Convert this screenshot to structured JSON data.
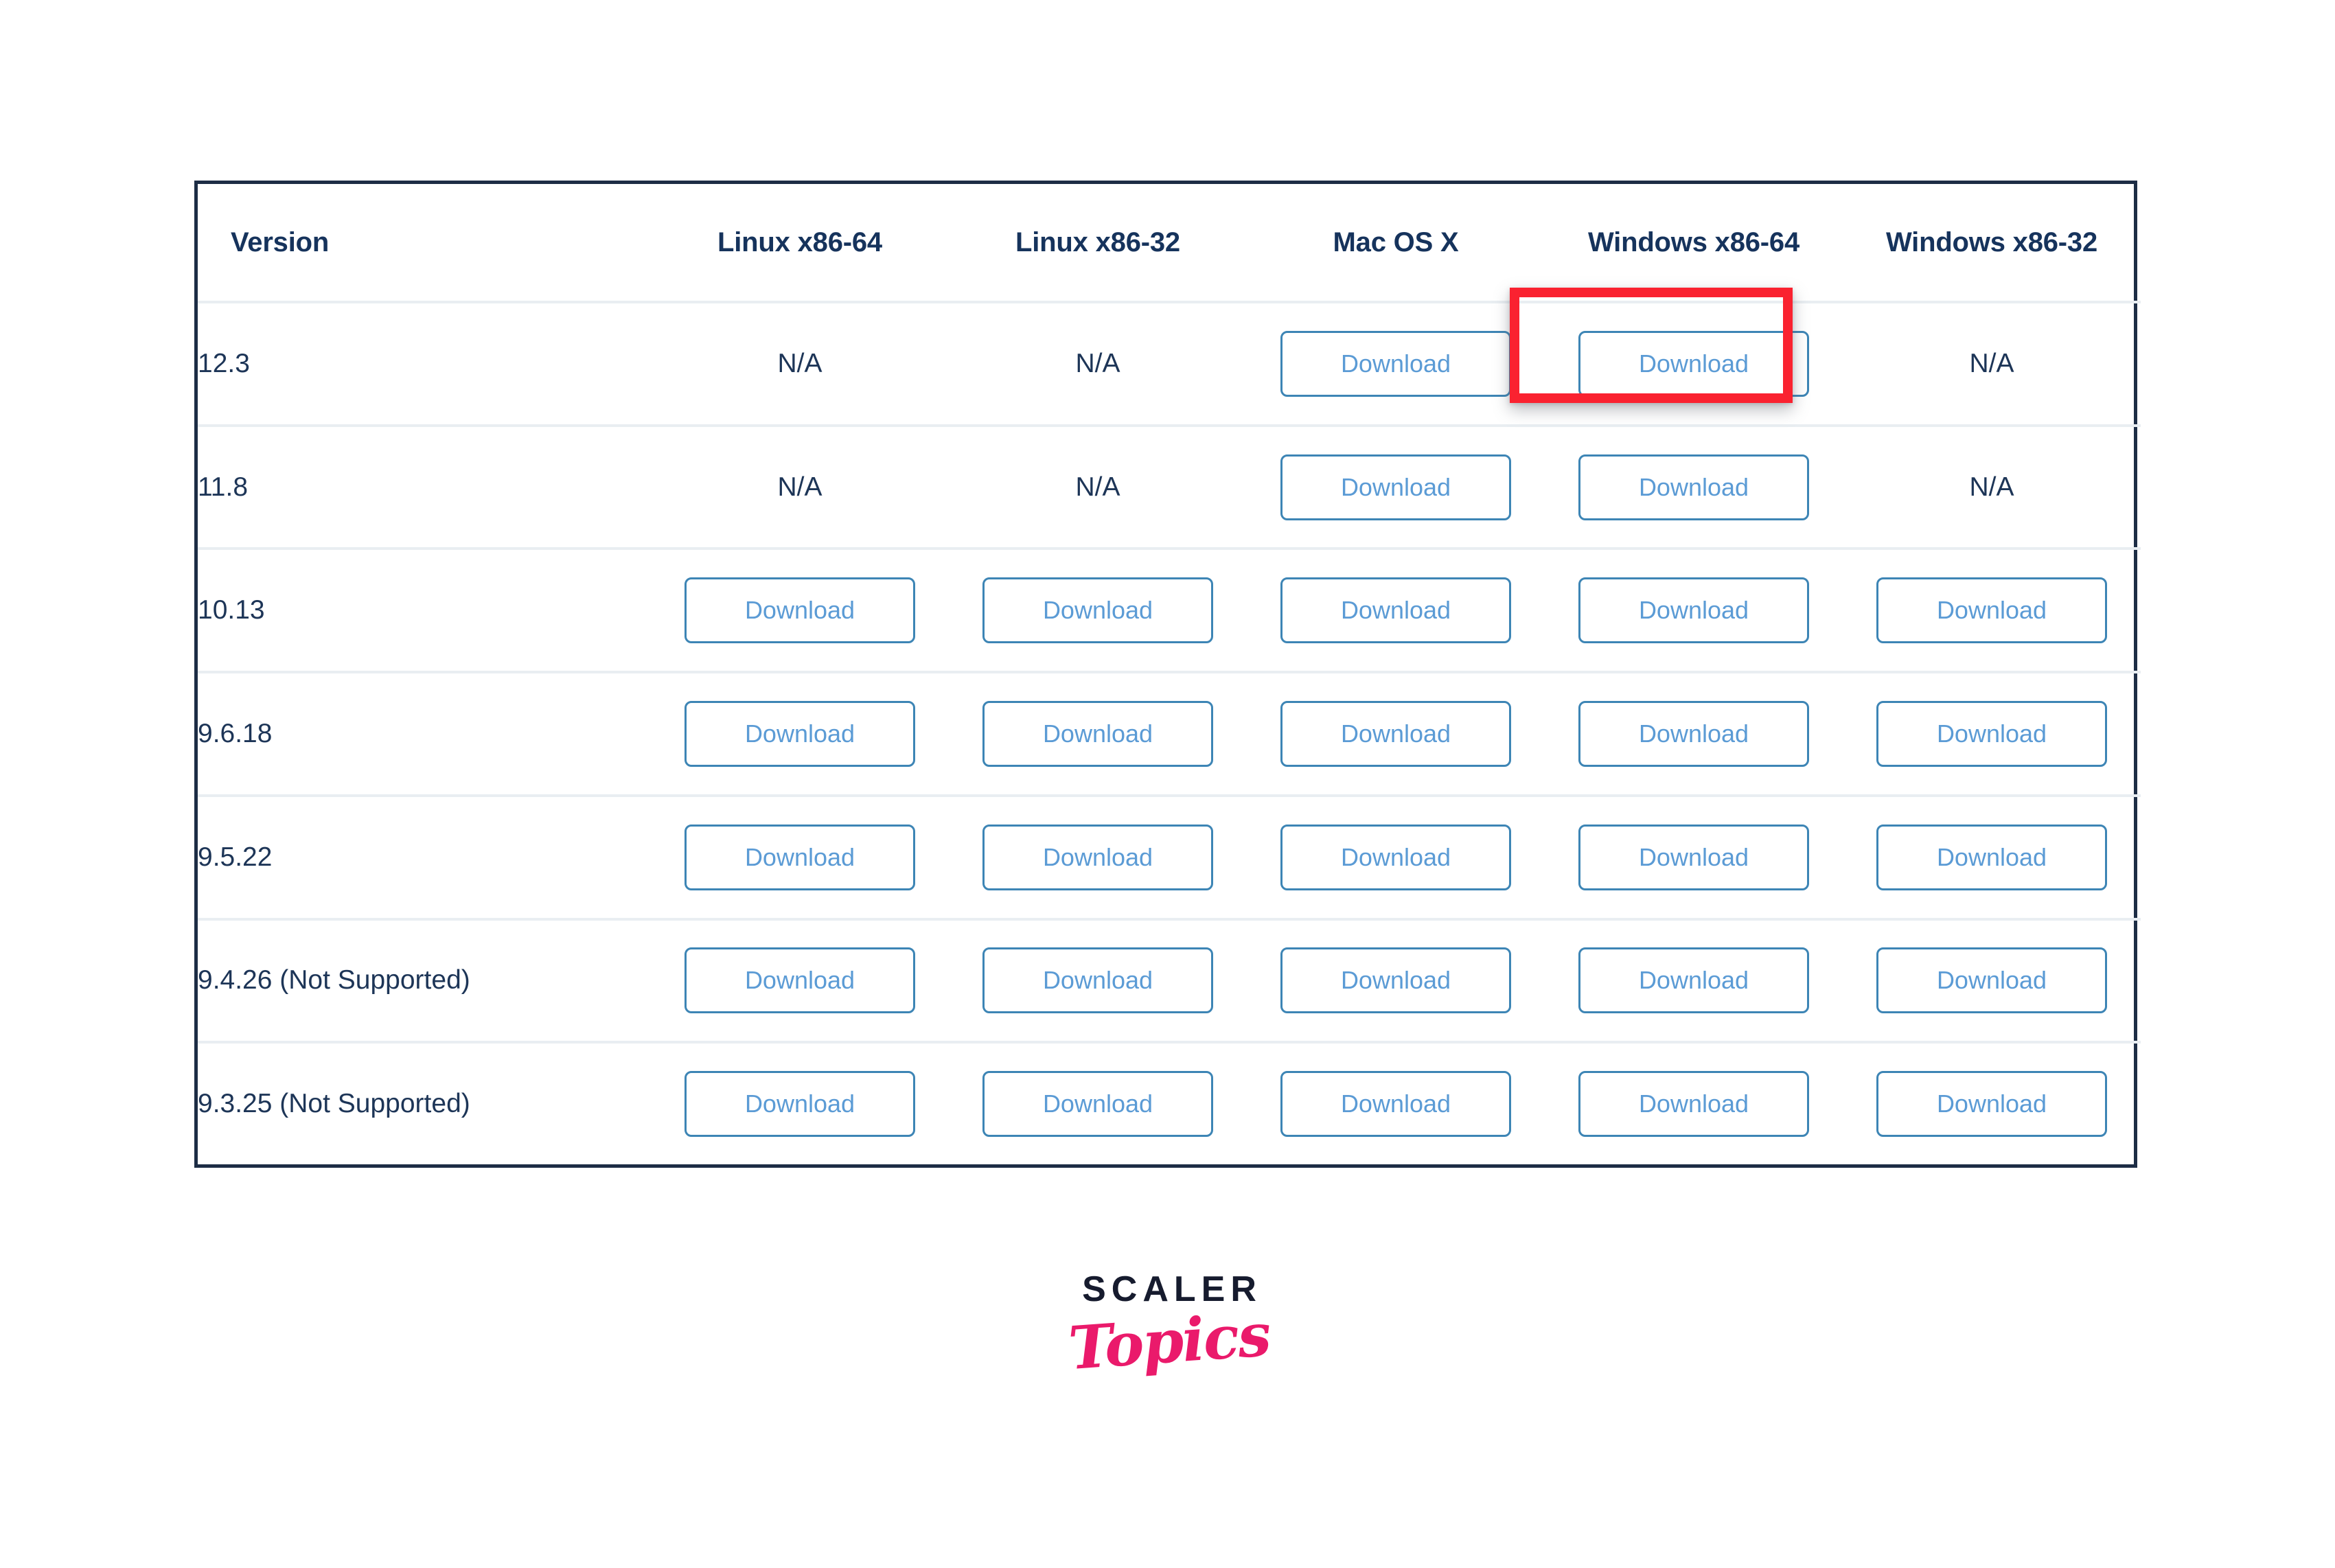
{
  "table": {
    "columns": [
      "Version",
      "Linux x86-64",
      "Linux x86-32",
      "Mac OS X",
      "Windows x86-64",
      "Windows x86-32"
    ],
    "download_label": "Download",
    "na_label": "N/A",
    "rows": [
      {
        "version": "12.3",
        "cells": [
          "N/A",
          "N/A",
          "Download",
          "Download",
          "N/A"
        ]
      },
      {
        "version": "11.8",
        "cells": [
          "N/A",
          "N/A",
          "Download",
          "Download",
          "N/A"
        ]
      },
      {
        "version": "10.13",
        "cells": [
          "Download",
          "Download",
          "Download",
          "Download",
          "Download"
        ]
      },
      {
        "version": "9.6.18",
        "cells": [
          "Download",
          "Download",
          "Download",
          "Download",
          "Download"
        ]
      },
      {
        "version": "9.5.22",
        "cells": [
          "Download",
          "Download",
          "Download",
          "Download",
          "Download"
        ]
      },
      {
        "version": "9.4.26 (Not Supported)",
        "cells": [
          "Download",
          "Download",
          "Download",
          "Download",
          "Download"
        ]
      },
      {
        "version": "9.3.25 (Not Supported)",
        "cells": [
          "Download",
          "Download",
          "Download",
          "Download",
          "Download"
        ]
      }
    ]
  },
  "annotation": {
    "target_row": "12.3",
    "target_column": "Windows x86-64",
    "target_label": "Download",
    "color": "#fa2230"
  },
  "logo": {
    "primary": "SCALER",
    "secondary": "Topics",
    "primary_color": "#161b2e",
    "secondary_color": "#ea1a6b"
  },
  "colors": {
    "table_border": "#1d2d45",
    "row_divider": "#e9eef2",
    "header_text": "#16335c",
    "body_text": "#1d3557",
    "button_border": "#3d85b5",
    "button_text": "#5b9bd5",
    "highlight": "#fa2230"
  }
}
